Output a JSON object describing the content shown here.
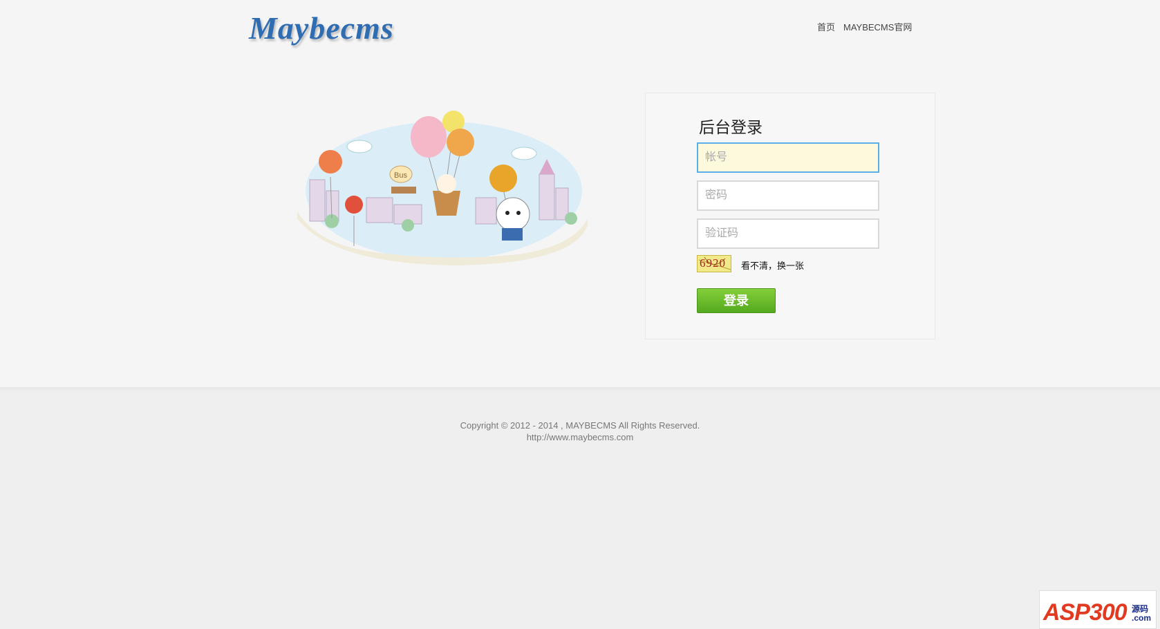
{
  "header": {
    "logo_text": "Maybecms",
    "nav": {
      "home": "首页",
      "official": "MAYBECMS官网"
    }
  },
  "illustration": {
    "bus_sign": "Bus"
  },
  "login": {
    "title": "后台登录",
    "username_placeholder": "帐号",
    "password_placeholder": "密码",
    "captcha_placeholder": "验证码",
    "captcha_text": "6920",
    "refresh_text": "看不清，换一张",
    "submit_label": "登录"
  },
  "footer": {
    "copyright": "Copyright © 2012 - 2014 , MAYBECMS All Rights Reserved.",
    "url": "http://www.maybecms.com"
  },
  "watermark": {
    "main": "ASP300",
    "side_top": "源码",
    "side_bottom": ".com"
  },
  "colors": {
    "accent_blue": "#2f6db3",
    "button_green": "#6cbf2c",
    "input_focus_bg": "#fdf9dd",
    "input_focus_border": "#5aaee8"
  }
}
